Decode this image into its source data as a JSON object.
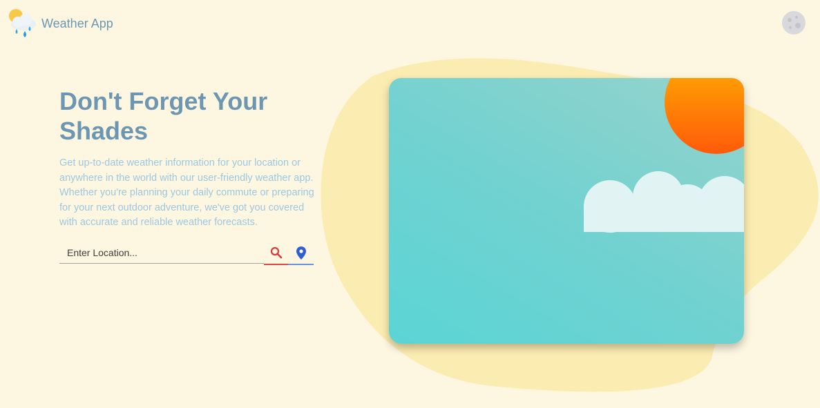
{
  "header": {
    "app_title": "Weather App",
    "logo_icon": "sun-cloud-rain-icon",
    "theme_toggle_icon": "moon-icon"
  },
  "hero": {
    "title": "Don't Forget Your Shades",
    "description": "Get up-to-date weather information for your location or anywhere in the world with our user-friendly weather app. Whether you're planning your daily commute or preparing for your next outdoor adventure, we've got you covered with accurate and reliable weather forecasts."
  },
  "search": {
    "placeholder": "Enter Location...",
    "value": "",
    "search_icon": "search-icon",
    "location_icon": "location-pin-icon"
  },
  "illustration": {
    "name": "sunny-sky-illustration",
    "elements": [
      "sun",
      "cloud"
    ]
  },
  "colors": {
    "background": "#fdf7e1",
    "accent": "#6d96b2",
    "search_underline": "#e04646",
    "location_underline": "#6b8fe0",
    "blob": "#fbecb1"
  }
}
